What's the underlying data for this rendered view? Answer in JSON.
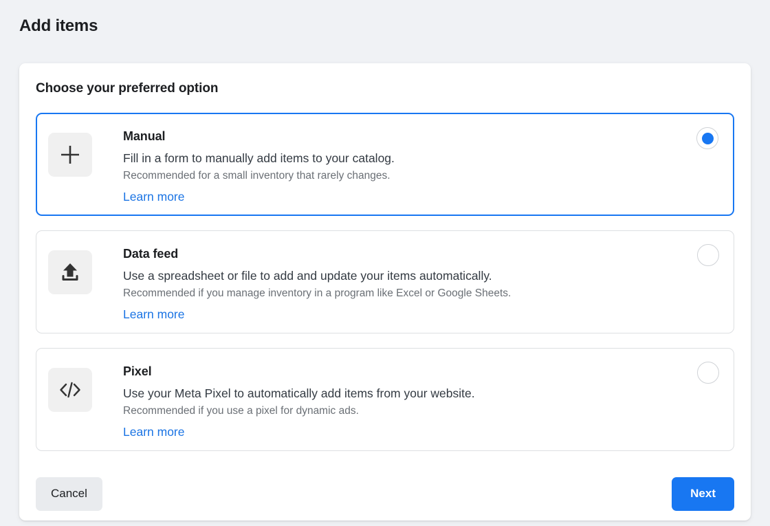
{
  "header": {
    "title": "Add items"
  },
  "panel": {
    "title": "Choose your preferred option",
    "options": [
      {
        "icon": "plus-icon",
        "title": "Manual",
        "description": "Fill in a form to manually add items to your catalog.",
        "recommendation": "Recommended for a small inventory that rarely changes.",
        "learn_more": "Learn more",
        "selected": true
      },
      {
        "icon": "upload-icon",
        "title": "Data feed",
        "description": "Use a spreadsheet or file to add and update your items automatically.",
        "recommendation": "Recommended if you manage inventory in a program like Excel or Google Sheets.",
        "learn_more": "Learn more",
        "selected": false
      },
      {
        "icon": "code-brackets-icon",
        "title": "Pixel",
        "description": "Use your Meta Pixel to automatically add items from your website.",
        "recommendation": "Recommended if you use a pixel for dynamic ads.",
        "learn_more": "Learn more",
        "selected": false
      }
    ]
  },
  "footer": {
    "cancel_label": "Cancel",
    "next_label": "Next"
  },
  "colors": {
    "accent": "#1877f2",
    "link": "#1b74e4",
    "page_background": "#f0f2f5",
    "panel_background": "#ffffff",
    "card_border": "#dddfe2",
    "icon_tile": "#f0f0f0",
    "cancel_button": "#e9ebee"
  }
}
